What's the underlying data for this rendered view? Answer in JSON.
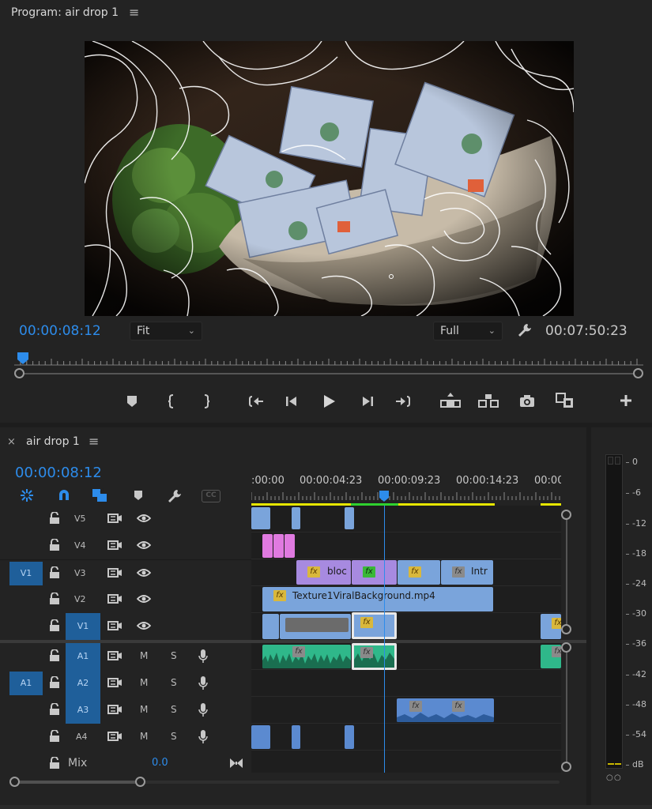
{
  "program_monitor": {
    "title": "Program: air drop 1",
    "menu_icon": "hamburger-menu-icon",
    "current_timecode": "00:00:08:12",
    "zoom_select": "Fit",
    "quality_select": "Full",
    "duration": "00:07:50:23",
    "settings_icon": "wrench-icon",
    "playhead_fraction": 0.01,
    "transport": [
      {
        "name": "add-marker-button",
        "icon": "marker-icon"
      },
      {
        "name": "mark-in-button",
        "icon": "mark-in-icon"
      },
      {
        "name": "mark-out-button",
        "icon": "mark-out-icon"
      },
      {
        "name": "go-to-in-button",
        "icon": "go-to-in-icon"
      },
      {
        "name": "step-back-button",
        "icon": "step-back-icon"
      },
      {
        "name": "play-button",
        "icon": "play-icon"
      },
      {
        "name": "step-forward-button",
        "icon": "step-forward-icon"
      },
      {
        "name": "go-to-out-button",
        "icon": "go-to-out-icon"
      },
      {
        "name": "lift-button",
        "icon": "lift-icon"
      },
      {
        "name": "extract-button",
        "icon": "extract-icon"
      },
      {
        "name": "export-frame-button",
        "icon": "camera-icon"
      },
      {
        "name": "comparison-view-button",
        "icon": "comparison-icon"
      },
      {
        "name": "add-button",
        "icon": "plus-icon"
      }
    ]
  },
  "timeline": {
    "sequence_name": "air drop 1",
    "close_icon": "close-icon",
    "menu_icon": "hamburger-menu-icon",
    "timecode": "00:00:08:12",
    "toolbar_icons": [
      "nest-icon",
      "snap-magnet-icon",
      "linked-selection-icon",
      "marker-icon",
      "wrench-icon",
      "captions-icon"
    ],
    "captions_label": "CC",
    "ruler_labels": [
      ":00:00",
      "00:00:04:23",
      "00:00:09:23",
      "00:00:14:23",
      "00:00"
    ],
    "video_tracks": [
      {
        "label": "V5",
        "source": ""
      },
      {
        "label": "V4",
        "source": ""
      },
      {
        "label": "V3",
        "source": "V1"
      },
      {
        "label": "V2",
        "source": ""
      },
      {
        "label": "V1",
        "source": ""
      }
    ],
    "audio_tracks": [
      {
        "label": "A1",
        "source": "",
        "m": "M",
        "s": "S"
      },
      {
        "label": "A2",
        "source": "A1",
        "m": "M",
        "s": "S"
      },
      {
        "label": "A3",
        "source": "",
        "m": "M",
        "s": "S"
      },
      {
        "label": "A4",
        "source": "",
        "m": "M",
        "s": "S"
      }
    ],
    "mix_label": "Mix",
    "mix_value": "0.0",
    "clip_labels": {
      "v3_bloc": "bloc",
      "v3_intr": "Intr",
      "v2_texture": "Texture1ViralBackground.mp4",
      "fx": "fx"
    }
  },
  "audio_meter": {
    "scale": [
      "0",
      "-6",
      "-12",
      "-18",
      "-24",
      "-30",
      "-36",
      "-42",
      "-48",
      "-54",
      "dB"
    ],
    "solo_labels": [
      "○",
      "○"
    ]
  },
  "colors": {
    "accent_blue": "#2d8ceb",
    "clip_blue": "#7aa4db",
    "clip_purple": "#a78ae0",
    "clip_pink": "#e07ae0",
    "clip_green": "#2fb88a",
    "work_area_yellow": "#e6e600"
  }
}
